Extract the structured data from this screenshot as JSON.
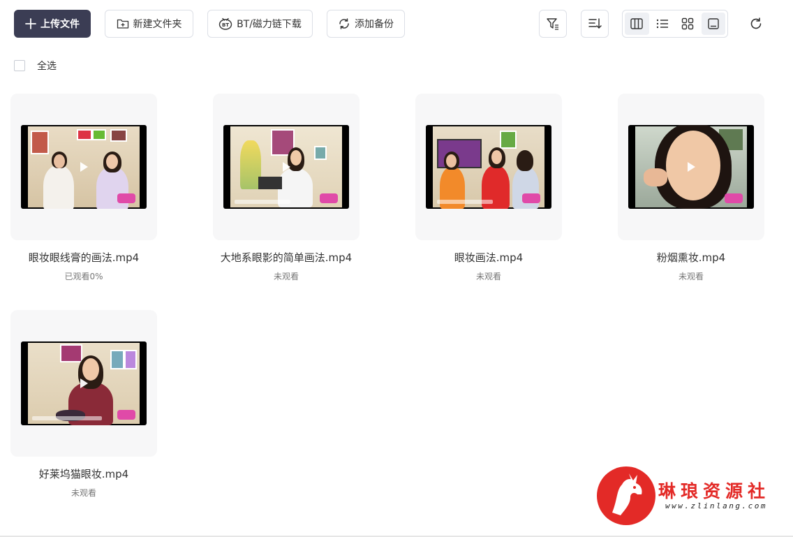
{
  "toolbar": {
    "upload_label": "上传文件",
    "new_folder_label": "新建文件夹",
    "bt_label": "BT/磁力链下载",
    "backup_label": "添加备份"
  },
  "select_all_label": "全选",
  "files": [
    {
      "name": "眼妆眼线膏的画法.mp4",
      "status": "已观看0%"
    },
    {
      "name": "大地系眼影的简单画法.mp4",
      "status": "未观看"
    },
    {
      "name": "眼妆画法.mp4",
      "status": "未观看"
    },
    {
      "name": "粉烟熏妆.mp4",
      "status": "未观看"
    },
    {
      "name": "好莱坞猫眼妆.mp4",
      "status": "未观看"
    }
  ],
  "watermark": {
    "title": "琳琅资源社",
    "url": "www.zlinlang.com",
    "color": "#e32a27"
  },
  "colors": {
    "primary_button": "#3b3d54",
    "border": "#dcdfe6",
    "card_bg": "#f7f7f8"
  }
}
